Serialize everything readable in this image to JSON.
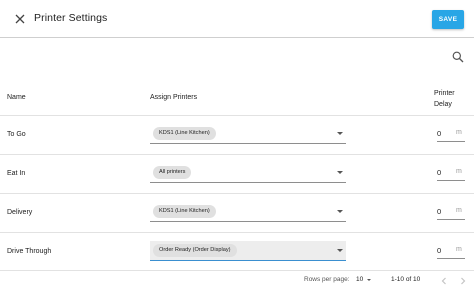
{
  "header": {
    "title": "Printer Settings",
    "save_label": "SAVE"
  },
  "columns": {
    "name": "Name",
    "assign": "Assign Printers",
    "delay_line1": "Printer",
    "delay_line2": "Delay"
  },
  "rows": [
    {
      "name": "To Go",
      "printer": "KDS1 (Line Kitchen)",
      "delay": "0",
      "unit": "m"
    },
    {
      "name": "Eat In",
      "printer": "All printers",
      "delay": "0",
      "unit": "m"
    },
    {
      "name": "Delivery",
      "printer": "KDS1 (Line Kitchen)",
      "delay": "0",
      "unit": "m"
    },
    {
      "name": "Drive Through",
      "printer": "Order Ready (Order Display)",
      "delay": "0",
      "unit": "m"
    }
  ],
  "pagination": {
    "rows_per_page_label": "Rows per page:",
    "rows_per_page": "10",
    "range": "1-10 of 10"
  },
  "colors": {
    "accent": "#29a6e6",
    "focus_underline": "#3a8fd0"
  }
}
